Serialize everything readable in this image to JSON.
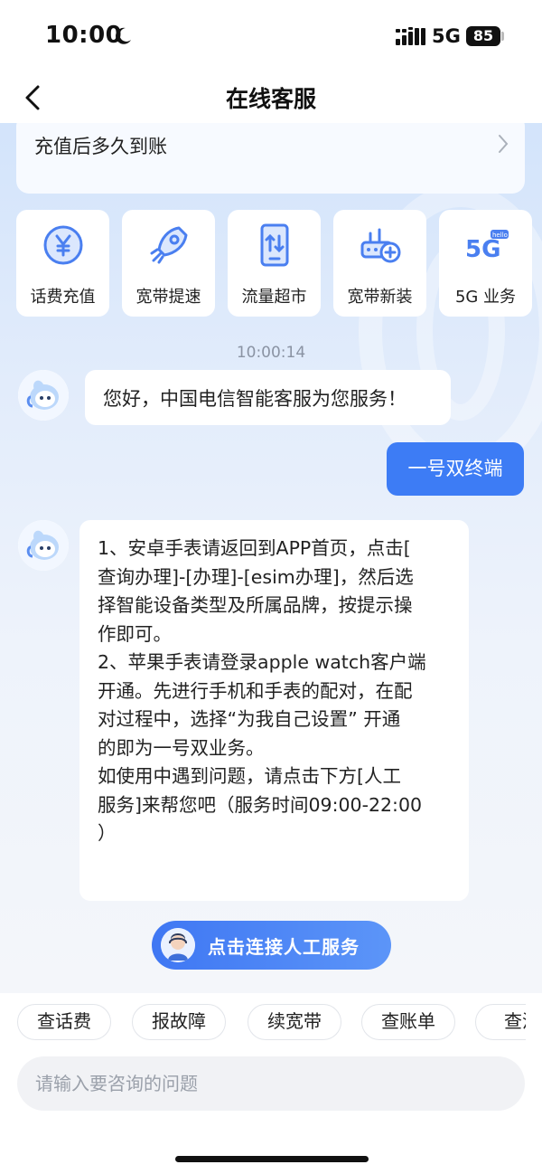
{
  "status_bar": {
    "time": "10:00",
    "network": "5G",
    "battery": "85"
  },
  "nav": {
    "title": "在线客服"
  },
  "faq": {
    "text": "充值后多久到账"
  },
  "quick_services": [
    {
      "label": "话费充值",
      "icon": "yuan-coin-icon"
    },
    {
      "label": "宽带提速",
      "icon": "rocket-icon"
    },
    {
      "label": "流量超市",
      "icon": "phone-data-icon"
    },
    {
      "label": "宽带新装",
      "icon": "router-add-icon"
    },
    {
      "label": "5G 业务",
      "icon": "5g-hello-icon"
    }
  ],
  "chat": {
    "timestamp": "10:00:14",
    "greeting": "您好，中国电信智能客服为您服务！",
    "user_message": "一号双终端",
    "answer_lines": [
      "1、安卓手表请返回到APP首页，点击[",
      "查询办理]-[办理]-[esim办理]，然后选",
      "择智能设备类型及所属品牌，按提示操",
      "作即可。",
      "2、苹果手表请登录apple watch客户端",
      "开通。先进行手机和手表的配对，在配",
      "对过程中，选择“为我自己设置” 开通",
      "的即为一号双业务。",
      "如使用中遇到问题，请点击下方[人工",
      "服务]来帮您吧（服务时间09:00-22:00",
      "）"
    ],
    "connect_button": "点击连接人工服务"
  },
  "chips": [
    "查话费",
    "报故障",
    "续宽带",
    "查账单",
    "查流"
  ],
  "input": {
    "placeholder": "请输入要咨询的问题",
    "value": ""
  },
  "colors": {
    "accent": "#3d7cf5",
    "chat_bg_top": "#d3e4fb",
    "icon_blue": "#4a7ff0"
  }
}
